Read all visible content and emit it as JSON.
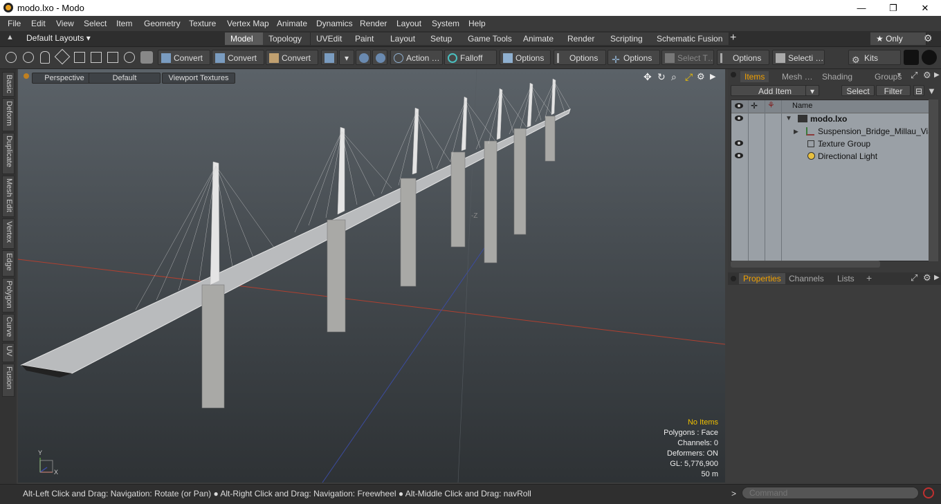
{
  "window": {
    "title": "modo.lxo - Modo",
    "minimize": "—",
    "maximize": "❐",
    "close": "✕"
  },
  "menu": [
    "File",
    "Edit",
    "View",
    "Select",
    "Item",
    "Geometry",
    "Texture",
    "Vertex Map",
    "Animate",
    "Dynamics",
    "Render",
    "Layout",
    "System",
    "Help"
  ],
  "layout": {
    "selector": "Default Layouts ▾",
    "tabs": [
      "Model",
      "Topology",
      "UVEdit",
      "Paint",
      "Layout",
      "Setup",
      "Game Tools",
      "Animate",
      "Render",
      "Scripting",
      "Schematic Fusion"
    ],
    "active": "Model",
    "add": "+",
    "only": "★  Only",
    "gear": "⚙"
  },
  "toolbar": {
    "convert1": "Convert",
    "convert2": "Convert",
    "convert3": "Convert",
    "action": "Action  …",
    "falloff": "Falloff",
    "options1": "Options",
    "options2": "Options",
    "options3": "Options",
    "select_t": "Select T…",
    "options4": "Options",
    "selecti": "Selecti …",
    "kits": "Kits"
  },
  "left_tabs": [
    "Basic",
    "Deform",
    "Duplicate",
    "Mesh Edit",
    "Vertex",
    "Edge",
    "Polygon",
    "Curve",
    "UV",
    "Fusion"
  ],
  "viewport": {
    "tabs": [
      "Perspective",
      "Default",
      "Viewport Textures"
    ],
    "axis_label": "-Z",
    "hud": {
      "no_items": "No Items",
      "polygons": "Polygons : Face",
      "channels": "Channels: 0",
      "deformers": "Deformers: ON",
      "gl": "GL: 5,776,900",
      "scale": "50 m"
    },
    "gizmo": {
      "x": "X",
      "y": "Y"
    }
  },
  "items_panel": {
    "tabs": [
      "Items",
      "Mesh …",
      "Shading",
      "Groups"
    ],
    "active_tab": "Items",
    "add_item": "Add Item",
    "select": "Select",
    "filter": "Filter",
    "column_name": "Name",
    "rows": [
      {
        "label": "modo.lxo",
        "eye": true,
        "indent": 0,
        "bold": true
      },
      {
        "label": "Suspension_Bridge_Millau_Via …",
        "eye": false,
        "indent": 1,
        "bold": false
      },
      {
        "label": "Texture Group",
        "eye": true,
        "indent": 1,
        "bold": false
      },
      {
        "label": "Directional Light",
        "eye": true,
        "indent": 1,
        "bold": false
      }
    ]
  },
  "properties_panel": {
    "tabs": [
      "Properties",
      "Channels",
      "Lists"
    ],
    "active_tab": "Properties",
    "add": "+"
  },
  "status": {
    "message": "Alt-Left Click and Drag: Navigation: Rotate (or Pan) ● Alt-Right Click and Drag: Navigation: Freewheel ● Alt-Middle Click and Drag: navRoll",
    "command_placeholder": "Command",
    "prompt": ">"
  }
}
